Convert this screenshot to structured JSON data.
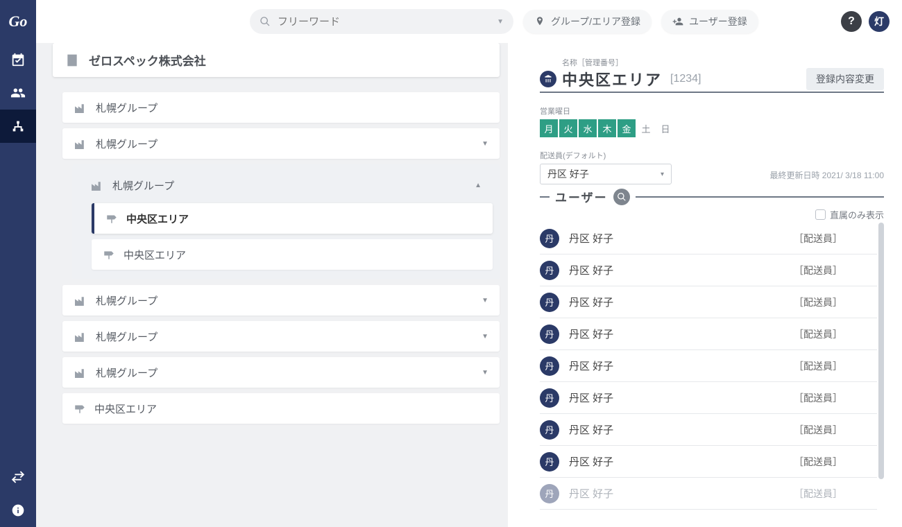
{
  "brand": {
    "logo": "Go",
    "avatar_initial": "灯"
  },
  "search": {
    "placeholder": "フリーワード"
  },
  "topbar": {
    "btn_group_area": "グループ/エリア登録",
    "btn_user_reg": "ユーザー登録"
  },
  "company": {
    "name": "ゼロスペック株式会社"
  },
  "tree": {
    "groups_collapsed": [
      {
        "label": "札幌グループ",
        "chevron": ""
      },
      {
        "label": "札幌グループ",
        "chevron": "▼"
      }
    ],
    "expanded": {
      "label": "札幌グループ",
      "chevron": "▲",
      "areas": [
        {
          "label": "中央区エリア",
          "active": true
        },
        {
          "label": "中央区エリア",
          "active": false
        }
      ]
    },
    "groups_after": [
      {
        "label": "札幌グループ",
        "chevron": "▼"
      },
      {
        "label": "札幌グループ",
        "chevron": "▼"
      },
      {
        "label": "札幌グループ",
        "chevron": "▼"
      }
    ],
    "loose_area": {
      "label": "中央区エリア"
    }
  },
  "detail": {
    "caption": "名称［管理番号］",
    "title": "中央区エリア",
    "code": "[1234]",
    "edit_label": "登録内容変更",
    "businessdays_label": "営業曜日",
    "days": [
      {
        "abbr": "月",
        "on": true
      },
      {
        "abbr": "火",
        "on": true
      },
      {
        "abbr": "水",
        "on": true
      },
      {
        "abbr": "木",
        "on": true
      },
      {
        "abbr": "金",
        "on": true
      },
      {
        "abbr": "土",
        "on": false
      },
      {
        "abbr": "日",
        "on": false
      }
    ],
    "deliverer_label": "配送員(デフォルト)",
    "deliverer_value": "丹区 好子",
    "updated_label": "最終更新日時",
    "updated_value": "2021/ 3/18 11:00",
    "users_header": "ユーザー",
    "filter_label": "直属のみ表示",
    "users": [
      {
        "avatar": "丹",
        "name": "丹区 好子",
        "role": "［配送員］",
        "faded": false
      },
      {
        "avatar": "丹",
        "name": "丹区 好子",
        "role": "［配送員］",
        "faded": false
      },
      {
        "avatar": "丹",
        "name": "丹区 好子",
        "role": "［配送員］",
        "faded": false
      },
      {
        "avatar": "丹",
        "name": "丹区 好子",
        "role": "［配送員］",
        "faded": false
      },
      {
        "avatar": "丹",
        "name": "丹区 好子",
        "role": "［配送員］",
        "faded": false
      },
      {
        "avatar": "丹",
        "name": "丹区 好子",
        "role": "［配送員］",
        "faded": false
      },
      {
        "avatar": "丹",
        "name": "丹区 好子",
        "role": "［配送員］",
        "faded": false
      },
      {
        "avatar": "丹",
        "name": "丹区 好子",
        "role": "［配送員］",
        "faded": false
      },
      {
        "avatar": "丹",
        "name": "丹区 好子",
        "role": "［配送員］",
        "faded": true
      }
    ]
  }
}
